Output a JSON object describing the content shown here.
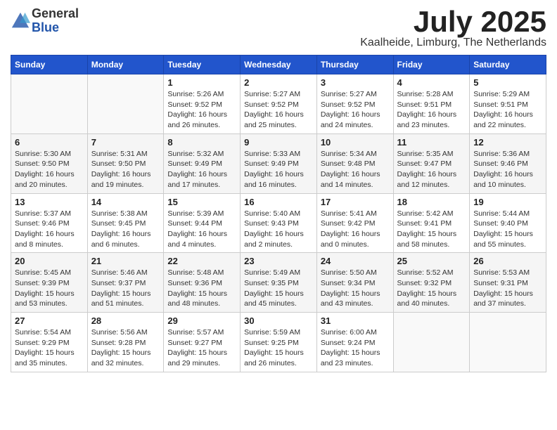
{
  "logo": {
    "general": "General",
    "blue": "Blue"
  },
  "title": "July 2025",
  "location": "Kaalheide, Limburg, The Netherlands",
  "days_of_week": [
    "Sunday",
    "Monday",
    "Tuesday",
    "Wednesday",
    "Thursday",
    "Friday",
    "Saturday"
  ],
  "weeks": [
    [
      {
        "day": "",
        "info": ""
      },
      {
        "day": "",
        "info": ""
      },
      {
        "day": "1",
        "info": "Sunrise: 5:26 AM\nSunset: 9:52 PM\nDaylight: 16 hours and 26 minutes."
      },
      {
        "day": "2",
        "info": "Sunrise: 5:27 AM\nSunset: 9:52 PM\nDaylight: 16 hours and 25 minutes."
      },
      {
        "day": "3",
        "info": "Sunrise: 5:27 AM\nSunset: 9:52 PM\nDaylight: 16 hours and 24 minutes."
      },
      {
        "day": "4",
        "info": "Sunrise: 5:28 AM\nSunset: 9:51 PM\nDaylight: 16 hours and 23 minutes."
      },
      {
        "day": "5",
        "info": "Sunrise: 5:29 AM\nSunset: 9:51 PM\nDaylight: 16 hours and 22 minutes."
      }
    ],
    [
      {
        "day": "6",
        "info": "Sunrise: 5:30 AM\nSunset: 9:50 PM\nDaylight: 16 hours and 20 minutes."
      },
      {
        "day": "7",
        "info": "Sunrise: 5:31 AM\nSunset: 9:50 PM\nDaylight: 16 hours and 19 minutes."
      },
      {
        "day": "8",
        "info": "Sunrise: 5:32 AM\nSunset: 9:49 PM\nDaylight: 16 hours and 17 minutes."
      },
      {
        "day": "9",
        "info": "Sunrise: 5:33 AM\nSunset: 9:49 PM\nDaylight: 16 hours and 16 minutes."
      },
      {
        "day": "10",
        "info": "Sunrise: 5:34 AM\nSunset: 9:48 PM\nDaylight: 16 hours and 14 minutes."
      },
      {
        "day": "11",
        "info": "Sunrise: 5:35 AM\nSunset: 9:47 PM\nDaylight: 16 hours and 12 minutes."
      },
      {
        "day": "12",
        "info": "Sunrise: 5:36 AM\nSunset: 9:46 PM\nDaylight: 16 hours and 10 minutes."
      }
    ],
    [
      {
        "day": "13",
        "info": "Sunrise: 5:37 AM\nSunset: 9:46 PM\nDaylight: 16 hours and 8 minutes."
      },
      {
        "day": "14",
        "info": "Sunrise: 5:38 AM\nSunset: 9:45 PM\nDaylight: 16 hours and 6 minutes."
      },
      {
        "day": "15",
        "info": "Sunrise: 5:39 AM\nSunset: 9:44 PM\nDaylight: 16 hours and 4 minutes."
      },
      {
        "day": "16",
        "info": "Sunrise: 5:40 AM\nSunset: 9:43 PM\nDaylight: 16 hours and 2 minutes."
      },
      {
        "day": "17",
        "info": "Sunrise: 5:41 AM\nSunset: 9:42 PM\nDaylight: 16 hours and 0 minutes."
      },
      {
        "day": "18",
        "info": "Sunrise: 5:42 AM\nSunset: 9:41 PM\nDaylight: 15 hours and 58 minutes."
      },
      {
        "day": "19",
        "info": "Sunrise: 5:44 AM\nSunset: 9:40 PM\nDaylight: 15 hours and 55 minutes."
      }
    ],
    [
      {
        "day": "20",
        "info": "Sunrise: 5:45 AM\nSunset: 9:39 PM\nDaylight: 15 hours and 53 minutes."
      },
      {
        "day": "21",
        "info": "Sunrise: 5:46 AM\nSunset: 9:37 PM\nDaylight: 15 hours and 51 minutes."
      },
      {
        "day": "22",
        "info": "Sunrise: 5:48 AM\nSunset: 9:36 PM\nDaylight: 15 hours and 48 minutes."
      },
      {
        "day": "23",
        "info": "Sunrise: 5:49 AM\nSunset: 9:35 PM\nDaylight: 15 hours and 45 minutes."
      },
      {
        "day": "24",
        "info": "Sunrise: 5:50 AM\nSunset: 9:34 PM\nDaylight: 15 hours and 43 minutes."
      },
      {
        "day": "25",
        "info": "Sunrise: 5:52 AM\nSunset: 9:32 PM\nDaylight: 15 hours and 40 minutes."
      },
      {
        "day": "26",
        "info": "Sunrise: 5:53 AM\nSunset: 9:31 PM\nDaylight: 15 hours and 37 minutes."
      }
    ],
    [
      {
        "day": "27",
        "info": "Sunrise: 5:54 AM\nSunset: 9:29 PM\nDaylight: 15 hours and 35 minutes."
      },
      {
        "day": "28",
        "info": "Sunrise: 5:56 AM\nSunset: 9:28 PM\nDaylight: 15 hours and 32 minutes."
      },
      {
        "day": "29",
        "info": "Sunrise: 5:57 AM\nSunset: 9:27 PM\nDaylight: 15 hours and 29 minutes."
      },
      {
        "day": "30",
        "info": "Sunrise: 5:59 AM\nSunset: 9:25 PM\nDaylight: 15 hours and 26 minutes."
      },
      {
        "day": "31",
        "info": "Sunrise: 6:00 AM\nSunset: 9:24 PM\nDaylight: 15 hours and 23 minutes."
      },
      {
        "day": "",
        "info": ""
      },
      {
        "day": "",
        "info": ""
      }
    ]
  ]
}
